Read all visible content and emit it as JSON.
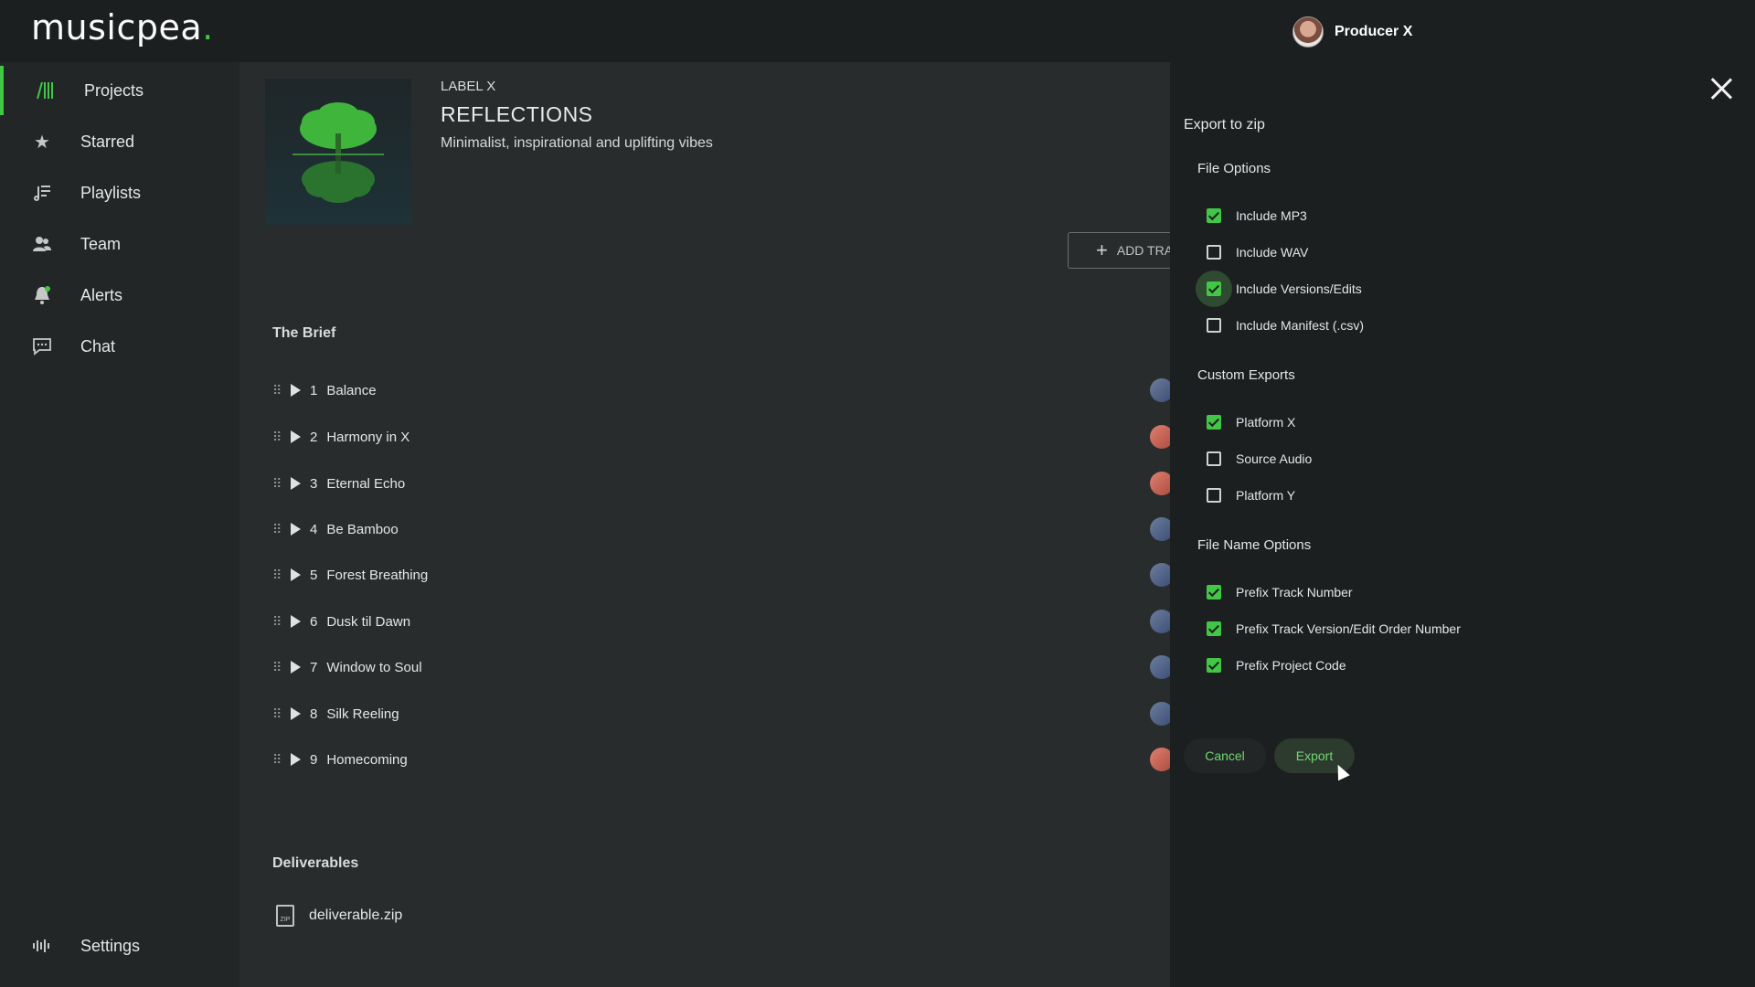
{
  "app": {
    "logo_text": "musicpea",
    "logo_dot": ".",
    "accent": "#41c645"
  },
  "user": {
    "name": "Producer X"
  },
  "sidebar": {
    "items": [
      {
        "label": "Projects",
        "icon": "projects-icon",
        "active": true
      },
      {
        "label": "Starred",
        "icon": "star-icon"
      },
      {
        "label": "Playlists",
        "icon": "playlist-icon"
      },
      {
        "label": "Team",
        "icon": "team-icon"
      },
      {
        "label": "Alerts",
        "icon": "bell-icon"
      },
      {
        "label": "Chat",
        "icon": "chat-icon"
      }
    ],
    "settings": {
      "label": "Settings",
      "icon": "settings-icon"
    }
  },
  "project": {
    "label": "LABEL X",
    "title": "REFLECTIONS",
    "subtitle": "Minimalist, inspirational and uplifting vibes",
    "add_button": "ADD TRA",
    "brief_heading": "The Brief",
    "tracks": [
      {
        "num": "1",
        "name": "Balance"
      },
      {
        "num": "2",
        "name": "Harmony in X"
      },
      {
        "num": "3",
        "name": "Eternal Echo"
      },
      {
        "num": "4",
        "name": "Be Bamboo"
      },
      {
        "num": "5",
        "name": "Forest Breathing"
      },
      {
        "num": "6",
        "name": "Dusk til Dawn"
      },
      {
        "num": "7",
        "name": "Window to Soul"
      },
      {
        "num": "8",
        "name": "Silk Reeling"
      },
      {
        "num": "9",
        "name": "Homecoming"
      }
    ],
    "deliverables_heading": "Deliverables",
    "deliverable_file": "deliverable.zip"
  },
  "export_panel": {
    "title": "Export to zip",
    "file_options": {
      "heading": "File Options",
      "options": [
        {
          "label": "Include MP3",
          "checked": true
        },
        {
          "label": "Include WAV",
          "checked": false
        },
        {
          "label": "Include Versions/Edits",
          "checked": true
        },
        {
          "label": "Include Manifest (.csv)",
          "checked": false
        }
      ]
    },
    "custom_exports": {
      "heading": "Custom Exports",
      "options": [
        {
          "label": "Platform X",
          "checked": true
        },
        {
          "label": "Source Audio",
          "checked": false
        },
        {
          "label": "Platform Y",
          "checked": false
        }
      ]
    },
    "file_name_options": {
      "heading": "File Name Options",
      "options": [
        {
          "label": "Prefix Track Number",
          "checked": true
        },
        {
          "label": "Prefix Track Version/Edit Order Number",
          "checked": true
        },
        {
          "label": "Prefix Project Code",
          "checked": true
        }
      ]
    },
    "cancel_label": "Cancel",
    "export_label": "Export"
  }
}
